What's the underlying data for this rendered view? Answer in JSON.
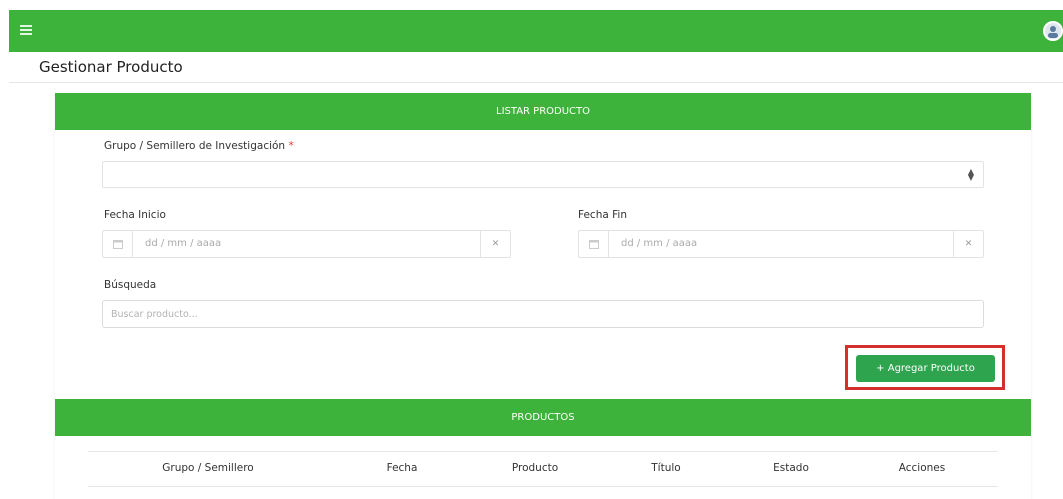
{
  "header": {
    "menu_icon": "menu-icon",
    "avatar_icon": "user-avatar"
  },
  "page": {
    "title": "Gestionar Producto"
  },
  "list_card": {
    "title": "LISTAR PRODUCTO",
    "group_label": "Grupo / Semillero de Investigación",
    "group_required": "*",
    "group_value": "",
    "start_date_label": "Fecha Inicio",
    "start_date_placeholder": "dd / mm / aaaa",
    "end_date_label": "Fecha Fin",
    "end_date_placeholder": "dd / mm / aaaa",
    "search_label": "Búsqueda",
    "search_placeholder": "Buscar producto...",
    "add_button": "+ Agregar Producto"
  },
  "products_card": {
    "title": "PRODUCTOS",
    "columns": [
      "Grupo / Semillero",
      "Fecha",
      "Producto",
      "Título",
      "Estado",
      "Acciones"
    ]
  },
  "colors": {
    "primary_green": "#3eb33c",
    "button_green": "#2ea44f",
    "highlight_red": "#d32f2f"
  }
}
